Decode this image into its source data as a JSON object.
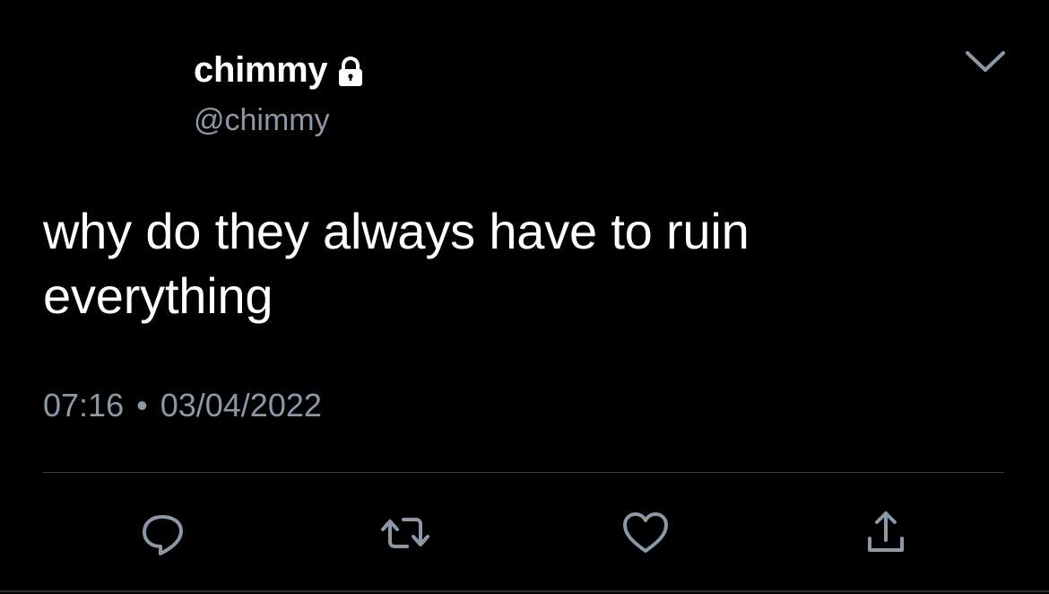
{
  "tweet": {
    "display_name": "chimmy",
    "handle": "@chimmy",
    "protected_icon": "lock-icon",
    "menu_icon": "chevron-down-icon",
    "text_line1": "why do they always have to ruin",
    "text_line2": "everything",
    "time": "07:16",
    "separator": "•",
    "date": "03/04/2022"
  },
  "actions": [
    {
      "name": "reply",
      "icon": "reply-icon"
    },
    {
      "name": "retweet",
      "icon": "retweet-icon"
    },
    {
      "name": "like",
      "icon": "heart-icon"
    },
    {
      "name": "share",
      "icon": "share-icon"
    }
  ],
  "colors": {
    "background": "#000000",
    "primary_text": "#ffffff",
    "secondary_text": "#8b98a5",
    "divider": "#3a3f44"
  }
}
